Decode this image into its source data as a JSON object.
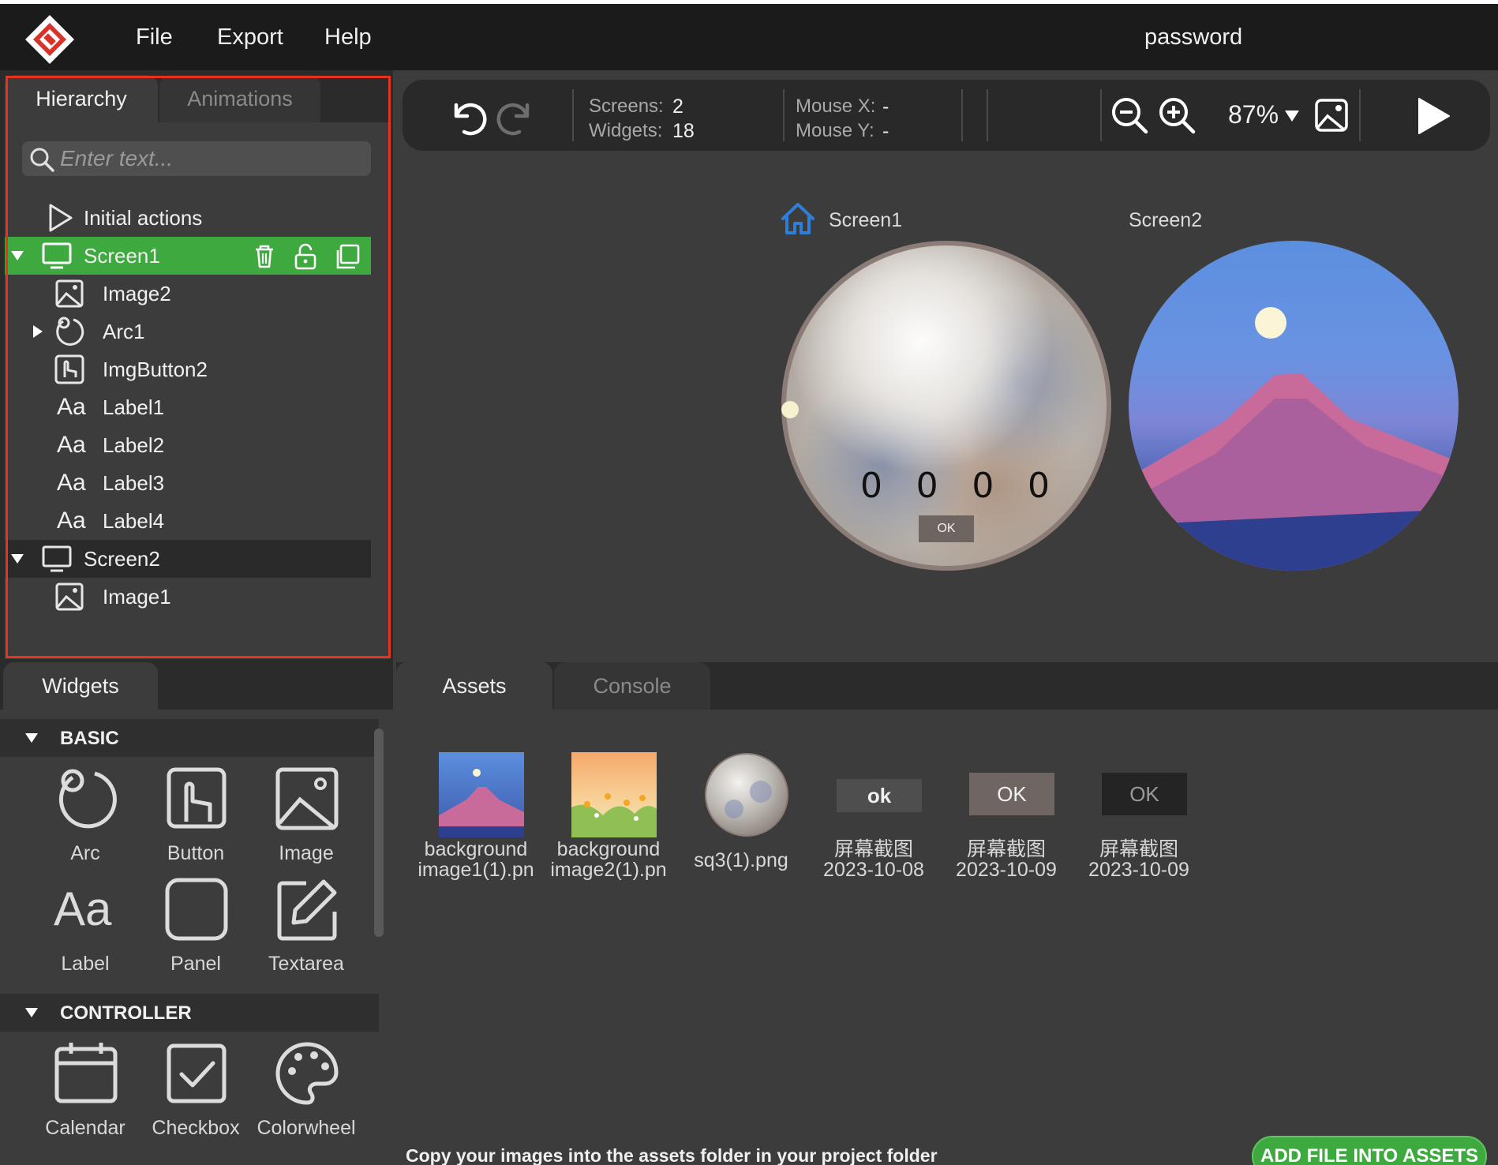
{
  "menubar": {
    "items": [
      "File",
      "Export",
      "Help"
    ],
    "project_name": "password"
  },
  "hierarchy": {
    "tabs": [
      "Hierarchy",
      "Animations"
    ],
    "search_placeholder": "Enter text...",
    "rows": [
      {
        "label": "Initial actions",
        "icon": "play-icon"
      },
      {
        "label": "Screen1",
        "icon": "monitor-icon"
      },
      {
        "label": "Image2",
        "icon": "image-icon"
      },
      {
        "label": "Arc1",
        "icon": "arc-icon"
      },
      {
        "label": "ImgButton2",
        "icon": "image-button-icon"
      },
      {
        "label": "Label1",
        "icon": "label-icon"
      },
      {
        "label": "Label2",
        "icon": "label-icon"
      },
      {
        "label": "Label3",
        "icon": "label-icon"
      },
      {
        "label": "Label4",
        "icon": "label-icon"
      },
      {
        "label": "Screen2",
        "icon": "monitor-icon"
      },
      {
        "label": "Image1",
        "icon": "image-icon"
      }
    ]
  },
  "toolbar": {
    "screens_label": "Screens:",
    "screens_value": "2",
    "widgets_label": "Widgets:",
    "widgets_value": "18",
    "mouse_x_label": "Mouse X:",
    "mouse_x_value": "-",
    "mouse_y_label": "Mouse Y:",
    "mouse_y_value": "-",
    "zoom": "87%"
  },
  "canvas": {
    "screen1_label": "Screen1",
    "screen2_label": "Screen2",
    "digits": [
      "0",
      "0",
      "0",
      "0"
    ],
    "ok_label": "OK"
  },
  "widgets": {
    "tab": "Widgets",
    "sections": [
      {
        "title": "BASIC",
        "items": [
          "Arc",
          "Button",
          "Image",
          "Label",
          "Panel",
          "Textarea"
        ]
      },
      {
        "title": "CONTROLLER",
        "items": [
          "Calendar",
          "Checkbox",
          "Colorwheel"
        ]
      }
    ]
  },
  "assets": {
    "tabs": [
      "Assets",
      "Console"
    ],
    "items": [
      {
        "line1": "background",
        "line2": "image1(1).pn"
      },
      {
        "line1": "background",
        "line2": "image2(1).pn"
      },
      {
        "line1": "sq3(1).png",
        "line2": ""
      },
      {
        "line1": "屏幕截图",
        "line2": "2023-10-08",
        "thumb_text": "ok"
      },
      {
        "line1": "屏幕截图",
        "line2": "2023-10-09",
        "thumb_text": "OK"
      },
      {
        "line1": "屏幕截图",
        "line2": "2023-10-09",
        "thumb_text": "OK"
      }
    ],
    "hint": "Copy your images into the assets folder in your project folder",
    "add_button": "ADD FILE INTO ASSETS"
  },
  "colors": {
    "accent_green": "#3ea93f",
    "outline_red": "#e8321e",
    "home_blue": "#2f7fd8"
  }
}
